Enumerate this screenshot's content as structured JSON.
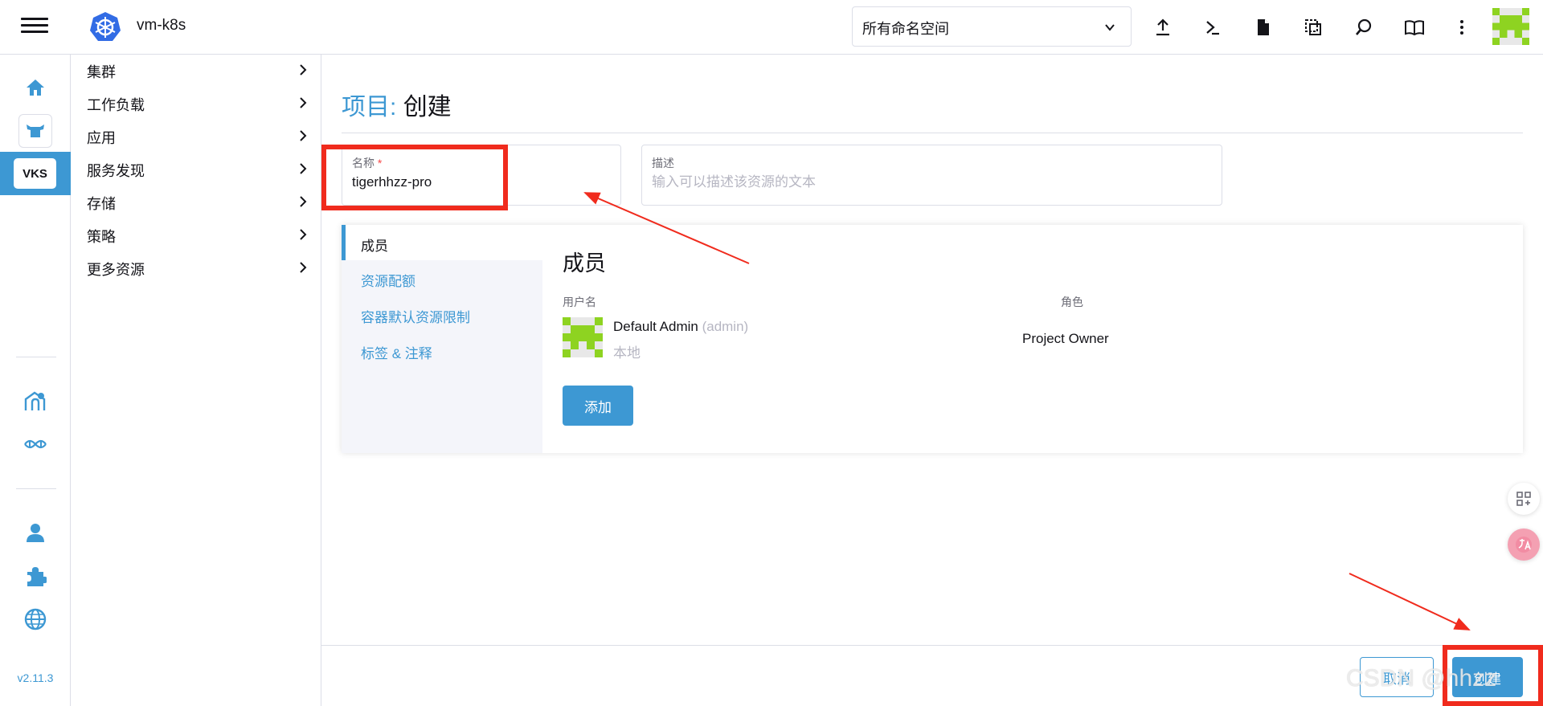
{
  "header": {
    "cluster_name": "vm-k8s",
    "namespace_select": {
      "value": "所有命名空间"
    },
    "icons": [
      "menu-icon",
      "kubernetes-logo",
      "upload-icon",
      "terminal-icon",
      "file-icon",
      "copy-icon",
      "search-icon",
      "book-icon",
      "more-vertical-icon",
      "user-avatar"
    ]
  },
  "rail": {
    "items": [
      {
        "name": "home-icon"
      },
      {
        "name": "rancher-logo-icon"
      },
      {
        "label": "VKS"
      },
      {
        "name": "fleet-icon"
      },
      {
        "name": "harvester-icon"
      },
      {
        "name": "user-icon"
      },
      {
        "name": "extensions-icon"
      },
      {
        "name": "globe-icon"
      }
    ],
    "version": "v2.11.3"
  },
  "sidenav": {
    "items": [
      {
        "label": "集群"
      },
      {
        "label": "工作负载"
      },
      {
        "label": "应用"
      },
      {
        "label": "服务发现"
      },
      {
        "label": "存储"
      },
      {
        "label": "策略"
      },
      {
        "label": "更多资源"
      }
    ]
  },
  "page": {
    "title_crumb": "项目:",
    "title_action": "创建"
  },
  "form": {
    "name": {
      "label": "名称",
      "required_mark": "*",
      "value": "tigerhhzz-pro"
    },
    "description": {
      "label": "描述",
      "placeholder": "输入可以描述该资源的文本"
    }
  },
  "tabs": [
    {
      "label": "成员",
      "active": true
    },
    {
      "label": "资源配额",
      "active": false
    },
    {
      "label": "容器默认资源限制",
      "active": false
    },
    {
      "label": "标签 & 注释",
      "active": false
    }
  ],
  "members": {
    "title": "成员",
    "col_user": "用户名",
    "col_role": "角色",
    "rows": [
      {
        "display_name": "Default Admin",
        "username": "(admin)",
        "source": "本地",
        "role": "Project Owner"
      }
    ],
    "add_label": "添加"
  },
  "footer": {
    "cancel_label": "取消",
    "create_label": "创建"
  },
  "watermark": "CSDN @hhzz",
  "colors": {
    "accent": "#3d98d3",
    "annotation_red": "#f02b1d",
    "avatar_green": "#8ed321"
  }
}
